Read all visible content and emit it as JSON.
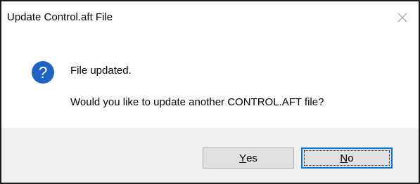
{
  "dialog": {
    "title": "Update Control.aft File",
    "icon": "question-icon",
    "message_line1": "File updated.",
    "message_line2": "Would you like to update another CONTROL.AFT file?",
    "close_icon": "close-icon"
  },
  "buttons": {
    "yes": {
      "mnemonic": "Y",
      "rest": "es"
    },
    "no": {
      "mnemonic": "N",
      "rest": "o"
    }
  },
  "colors": {
    "icon_blue": "#1e62c4",
    "focus_border": "#0078d7",
    "footer_bg": "#f0f0f0"
  }
}
